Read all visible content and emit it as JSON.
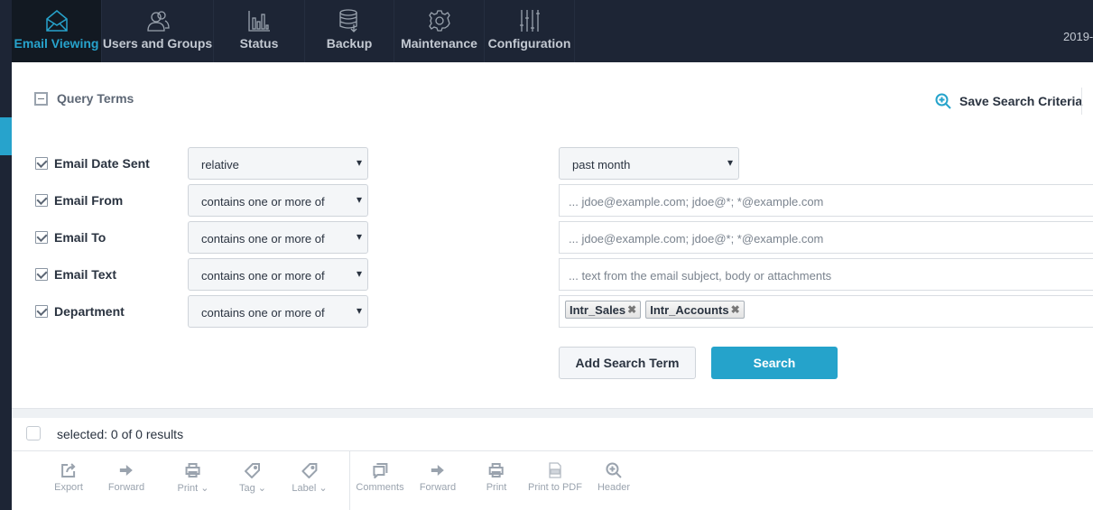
{
  "nav": {
    "items": [
      {
        "label": "Email Viewing",
        "icon": "envelope-icon",
        "active": true
      },
      {
        "label": "Users and Groups",
        "icon": "users-icon"
      },
      {
        "label": "Status",
        "icon": "bar-chart-icon"
      },
      {
        "label": "Backup",
        "icon": "database-icon"
      },
      {
        "label": "Maintenance",
        "icon": "gear-icon"
      },
      {
        "label": "Configuration",
        "icon": "sliders-icon"
      }
    ],
    "date": "2019-"
  },
  "query": {
    "title": "Query Terms",
    "save_label": "Save Search Criteria",
    "rows": [
      {
        "label": "Email Date Sent",
        "operator": "relative",
        "value": "past month"
      },
      {
        "label": "Email From",
        "operator": "contains one or more of",
        "placeholder": "... jdoe@example.com; jdoe@*; *@example.com"
      },
      {
        "label": "Email To",
        "operator": "contains one or more of",
        "placeholder": "... jdoe@example.com; jdoe@*; *@example.com"
      },
      {
        "label": "Email Text",
        "operator": "contains one or more of",
        "placeholder": "... text from the email subject, body or attachments"
      },
      {
        "label": "Department",
        "operator": "contains one or more of",
        "tags": [
          "Intr_Sales",
          "Intr_Accounts"
        ]
      }
    ],
    "add_label": "Add Search Term",
    "search_label": "Search"
  },
  "results": {
    "selected_text": "selected: 0 of 0 results"
  },
  "toolbar": {
    "left": [
      {
        "label": "Export",
        "icon": "export-icon"
      },
      {
        "label": "Forward",
        "icon": "arrow-right-icon"
      },
      {
        "label": "Print",
        "icon": "printer-icon",
        "dropdown": true
      },
      {
        "label": "Tag",
        "icon": "tag-icon",
        "dropdown": true
      },
      {
        "label": "Label",
        "icon": "label-icon",
        "dropdown": true
      }
    ],
    "right": [
      {
        "label": "Comments",
        "icon": "comments-icon"
      },
      {
        "label": "Forward",
        "icon": "arrow-right-icon"
      },
      {
        "label": "Print",
        "icon": "printer-icon"
      },
      {
        "label": "Print to PDF",
        "icon": "pdf-icon"
      },
      {
        "label": "Header",
        "icon": "zoom-in-icon"
      }
    ]
  },
  "colors": {
    "accent": "#25a3cb",
    "topbar": "#1d2535"
  }
}
